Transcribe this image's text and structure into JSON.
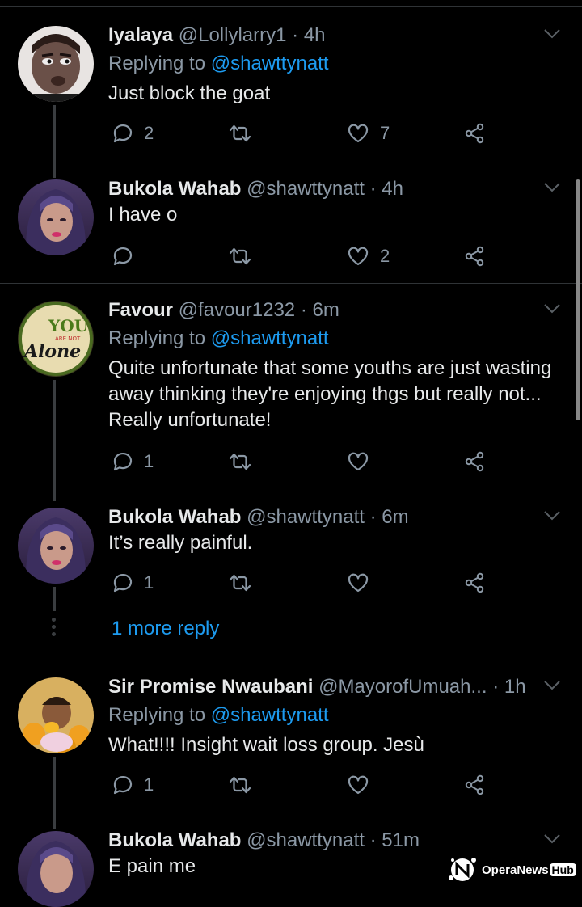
{
  "tweets": [
    {
      "name": "Iyalaya",
      "handle": "@Lollylarry1",
      "dot": "·",
      "time": "4h",
      "replying_prefix": "Replying to",
      "replying_to": "@shawttynatt",
      "text": "Just block the goat",
      "replies": "2",
      "retweets": "",
      "likes": "7"
    },
    {
      "name": "Bukola Wahab",
      "handle": "@shawttynatt",
      "dot": "·",
      "time": "4h",
      "text": "I have o",
      "replies": "",
      "retweets": "",
      "likes": "2"
    },
    {
      "name": "Favour",
      "handle": "@favour1232",
      "dot": "·",
      "time": "6m",
      "replying_prefix": "Replying to",
      "replying_to": "@shawttynatt",
      "text": "Quite unfortunate that some youths are just wasting away thinking they're enjoying thgs but really not... Really unfortunate!",
      "replies": "1",
      "retweets": "",
      "likes": ""
    },
    {
      "name": "Bukola Wahab",
      "handle": "@shawttynatt",
      "dot": "·",
      "time": "6m",
      "text": "It’s really painful.",
      "replies": "1",
      "retweets": "",
      "likes": ""
    },
    {
      "name": "Sir Promise Nwaubani",
      "handle": "@MayorofUmuah...",
      "dot": "·",
      "time": "1h",
      "replying_prefix": "Replying to",
      "replying_to": "@shawttynatt",
      "text": "What!!!! Insight wait loss group. Jesù",
      "replies": "1",
      "retweets": "",
      "likes": ""
    },
    {
      "name": "Bukola Wahab",
      "handle": "@shawttynatt",
      "dot": "·",
      "time": "51m",
      "text": "E pain me"
    }
  ],
  "more_reply": "1 more reply",
  "avatar_badge": {
    "line1": "YOU",
    "line2": "ARE NOT",
    "line3": "Alone"
  },
  "watermark": {
    "brand": "OperaNews",
    "hub": "Hub"
  },
  "colors": {
    "background": "#000000",
    "link": "#1d9bf0",
    "muted": "#8b98a5",
    "separator": "#2f3336"
  },
  "icons": [
    "reply-icon",
    "retweet-icon",
    "like-icon",
    "share-icon",
    "chevron-down-icon"
  ]
}
